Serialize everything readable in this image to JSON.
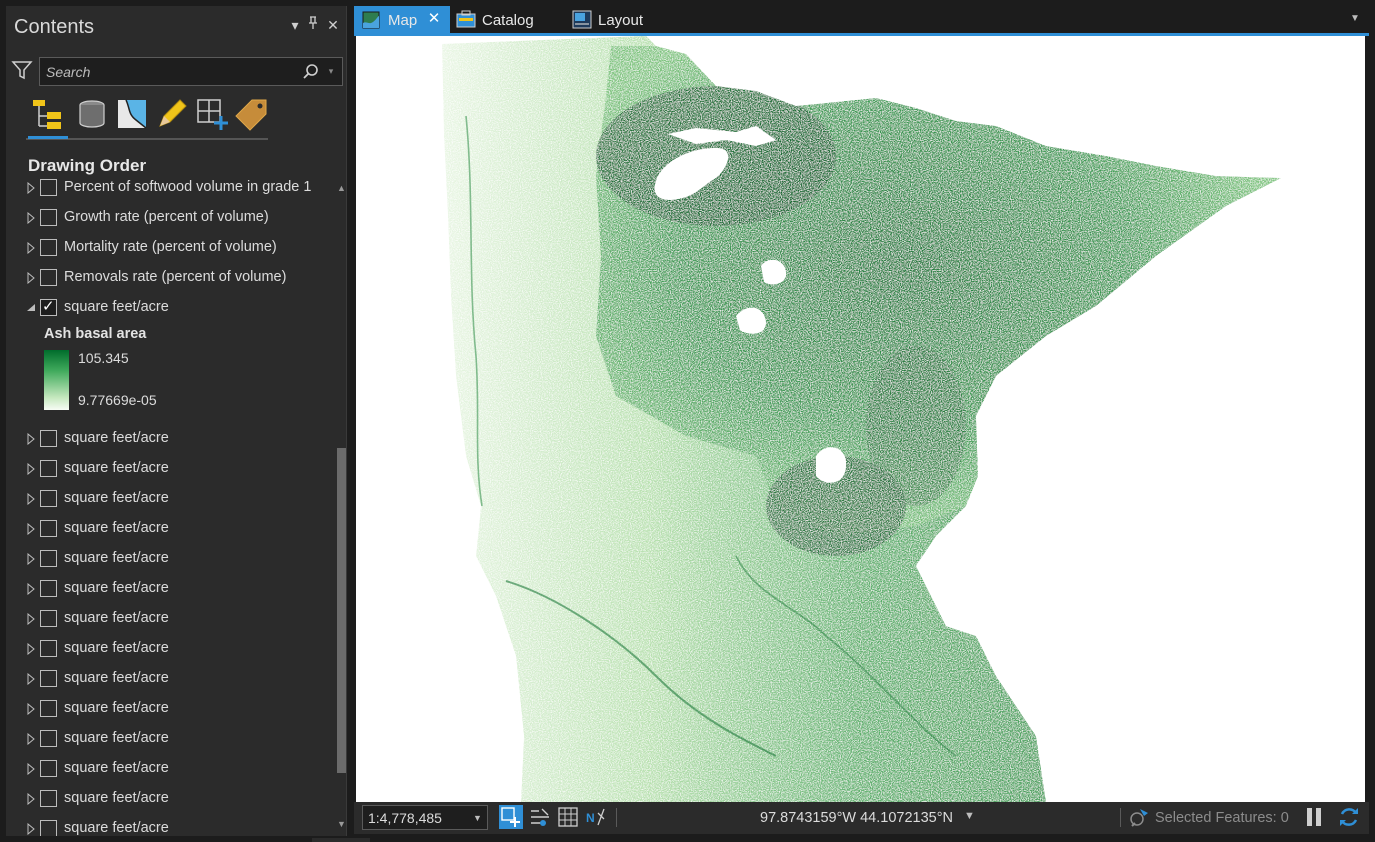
{
  "contents": {
    "title": "Contents",
    "header_icons": [
      "dropdown-arrow-icon",
      "pin-icon",
      "close-icon"
    ],
    "search": {
      "placeholder": "Search"
    },
    "tool_icons": [
      "list-by-drawing-order-icon",
      "list-by-source-icon",
      "list-by-selection-icon",
      "list-by-editing-icon",
      "list-by-snapping-icon",
      "list-by-labeling-icon"
    ],
    "section_heading": "Drawing Order",
    "layers_top": [
      {
        "label": "Percent of softwood volume in grade 1",
        "checked": false
      },
      {
        "label": "Growth rate (percent of volume)",
        "checked": false
      },
      {
        "label": "Mortality rate (percent of volume)",
        "checked": false
      },
      {
        "label": "Removals rate (percent of volume)",
        "checked": false
      },
      {
        "label": "square feet/acre",
        "checked": true,
        "expanded": true
      }
    ],
    "legend": {
      "title": "Ash basal area",
      "high": "105.345",
      "low": "9.77669e-05",
      "ramp_colors": [
        "#006d2c",
        "#41ab5d",
        "#c7e9c0",
        "#f7fcf5"
      ]
    },
    "layers_bottom": [
      {
        "label": "square feet/acre",
        "checked": false
      },
      {
        "label": "square feet/acre",
        "checked": false
      },
      {
        "label": "square feet/acre",
        "checked": false
      },
      {
        "label": "square feet/acre",
        "checked": false
      },
      {
        "label": "square feet/acre",
        "checked": false
      },
      {
        "label": "square feet/acre",
        "checked": false
      },
      {
        "label": "square feet/acre",
        "checked": false
      },
      {
        "label": "square feet/acre",
        "checked": false
      },
      {
        "label": "square feet/acre",
        "checked": false
      },
      {
        "label": "square feet/acre",
        "checked": false
      },
      {
        "label": "square feet/acre",
        "checked": false
      },
      {
        "label": "square feet/acre",
        "checked": false
      },
      {
        "label": "square feet/acre",
        "checked": false
      },
      {
        "label": "square feet/acre",
        "checked": false
      }
    ]
  },
  "tabs": [
    {
      "label": "Map",
      "active": true,
      "icon": "map-icon"
    },
    {
      "label": "Catalog",
      "active": false,
      "icon": "catalog-icon"
    },
    {
      "label": "Layout",
      "active": false,
      "icon": "layout-icon"
    }
  ],
  "map": {
    "description_colors": {
      "dark": "#00441b",
      "mid": "#238b45",
      "light": "#a1d99b",
      "background": "#ffffff"
    }
  },
  "status": {
    "scale": "1:4,778,485",
    "coordinates": "97.8743159°W 44.1072135°N",
    "selected_features": "Selected Features: 0",
    "icons": [
      "navigation-mode-icon",
      "snapping-icon",
      "grid-icon",
      "north-arrow-icon",
      "selected-features-icon",
      "pause-drawing-icon",
      "refresh-icon"
    ]
  },
  "accent_color": "#2f8fd6"
}
